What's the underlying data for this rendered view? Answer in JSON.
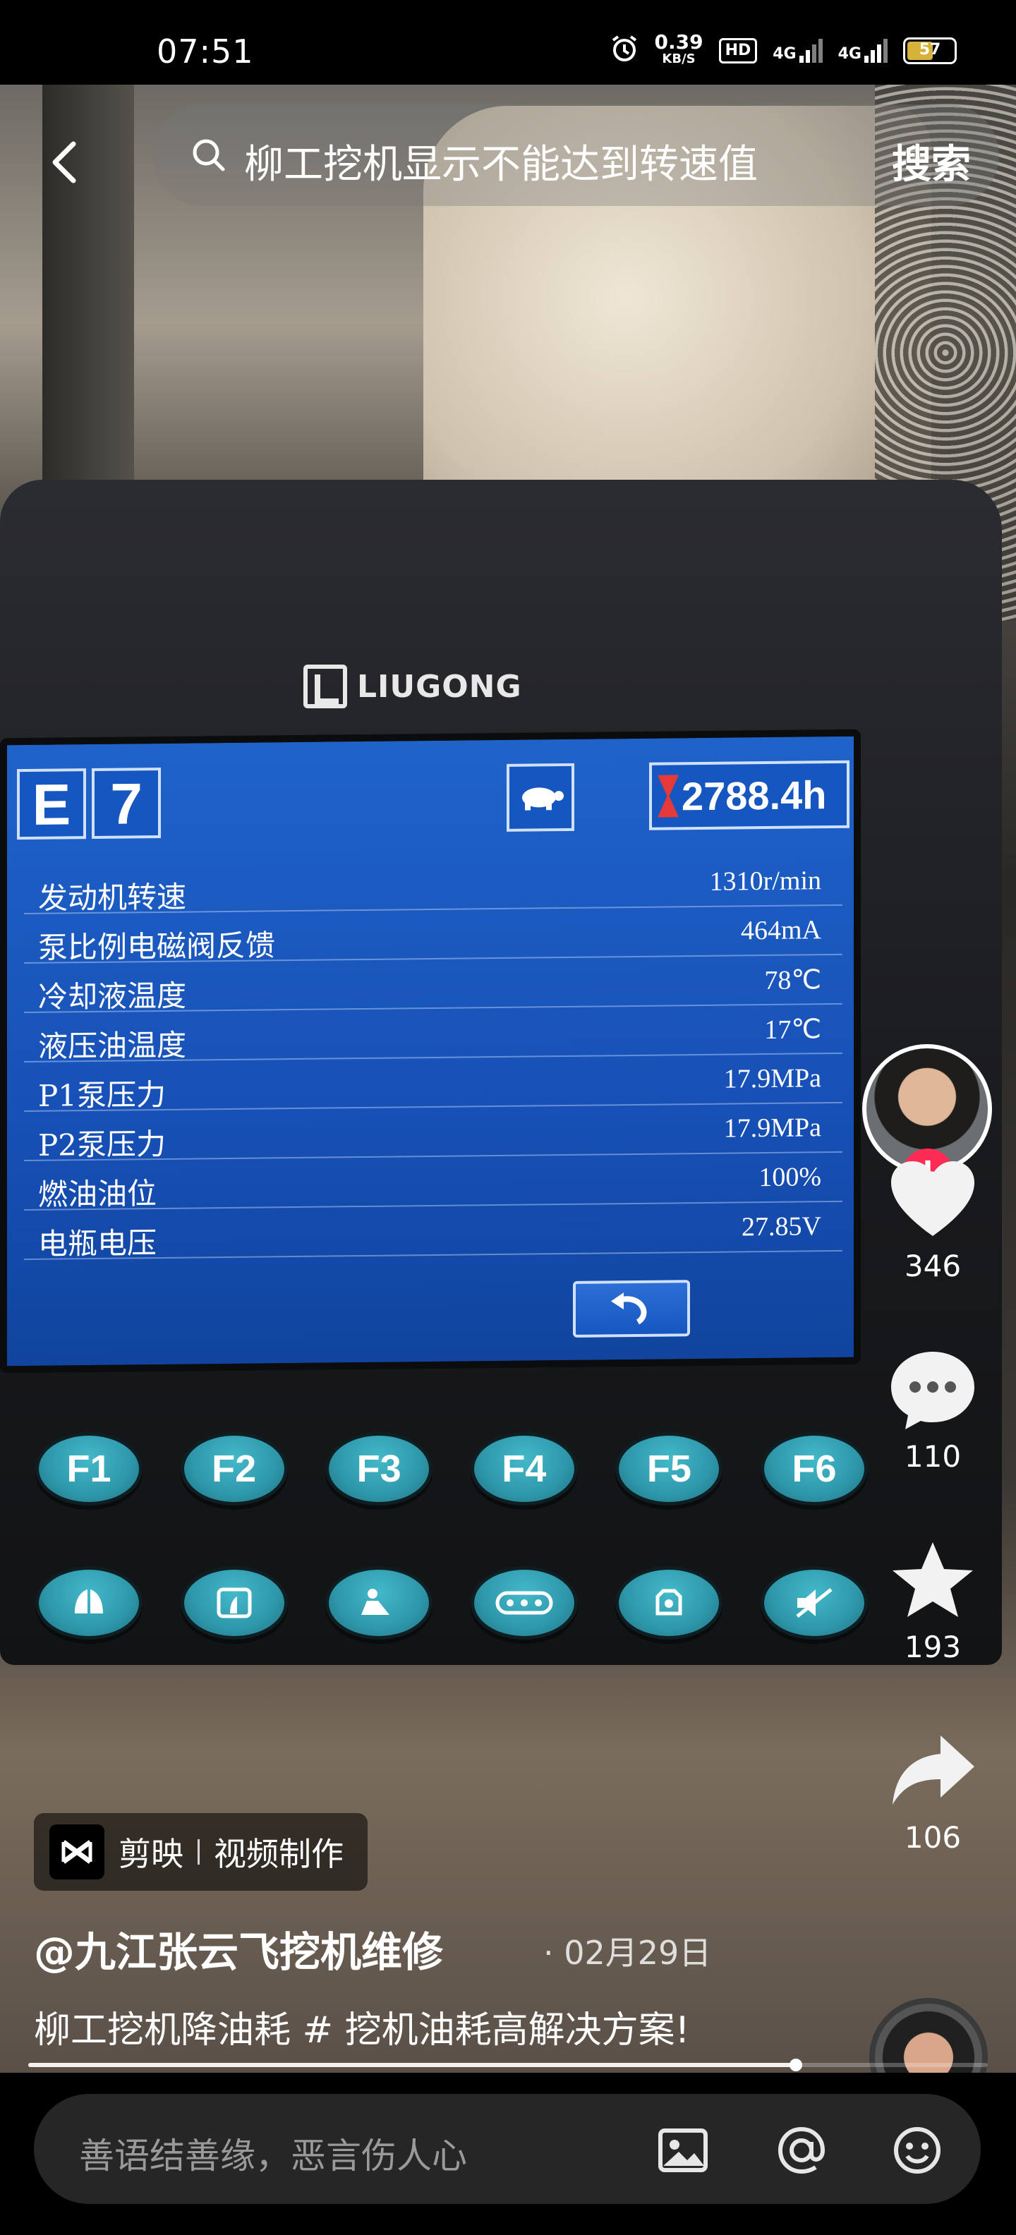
{
  "status_bar": {
    "time": "07:51",
    "net_speed": "0.39",
    "net_unit": "KB/S",
    "hd_label": "HD",
    "signal1_label": "4G",
    "signal2_label": "4G",
    "battery": "57"
  },
  "search": {
    "query": "柳工挖机显示不能达到转速值",
    "button": "搜索"
  },
  "monitor": {
    "brand": "LIUGONG",
    "code_letter": "E",
    "code_number": "7",
    "hours": "2788.4h",
    "rows": [
      {
        "label": "发动机转速",
        "value": "1310r/min"
      },
      {
        "label": "泵比例电磁阀反馈",
        "value": "464mA"
      },
      {
        "label": "冷却液温度",
        "value": "78℃"
      },
      {
        "label": "液压油温度",
        "value": "17℃"
      },
      {
        "label": "P1泵压力",
        "value": "17.9MPa"
      },
      {
        "label": "P2泵压力",
        "value": "17.9MPa"
      },
      {
        "label": "燃油油位",
        "value": "100%"
      },
      {
        "label": "电瓶电压",
        "value": "27.85V"
      }
    ],
    "fkeys": [
      "F1",
      "F2",
      "F3",
      "F4",
      "F5",
      "F6"
    ]
  },
  "video": {
    "capcut_label": "剪映",
    "capcut_sub": "视频制作",
    "author": "@九江张云飞挖机维修",
    "date": "· 02月29日",
    "description": "柳工挖机降油耗 # 挖机油耗高解决方案!",
    "progress": 0.8
  },
  "actions": {
    "likes": "346",
    "comments": "110",
    "favorites": "193",
    "shares": "106"
  },
  "comment_bar": {
    "placeholder": "善语结善缘，恶言伤人心"
  }
}
